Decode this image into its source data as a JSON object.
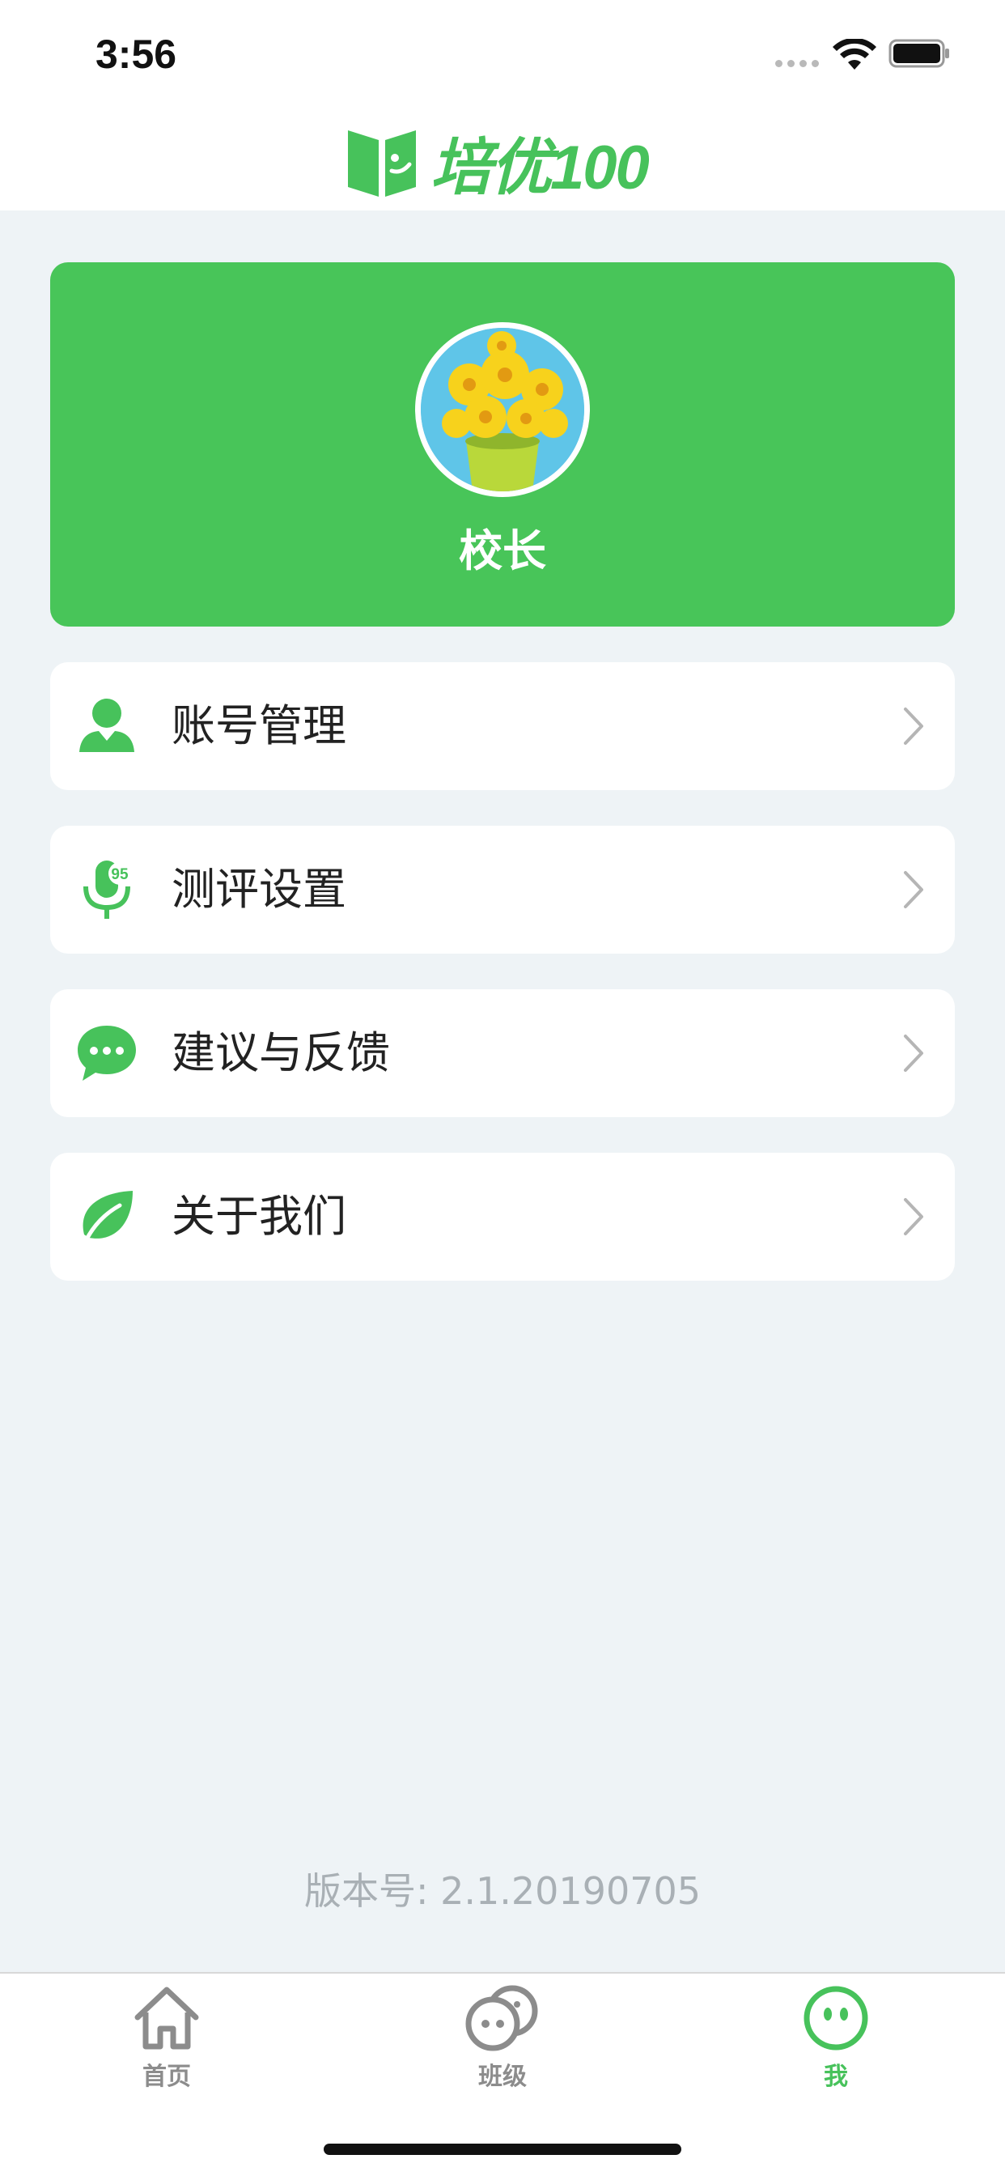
{
  "status_bar": {
    "time": "3:56"
  },
  "header": {
    "logo_text": "培优100"
  },
  "profile": {
    "name": "校长"
  },
  "menu": [
    {
      "label": "账号管理",
      "icon": "user-icon"
    },
    {
      "label": "测评设置",
      "icon": "microphone-score-icon",
      "icon_badge": "95"
    },
    {
      "label": "建议与反馈",
      "icon": "chat-bubble-icon"
    },
    {
      "label": "关于我们",
      "icon": "leaf-icon"
    }
  ],
  "footer": {
    "version": "版本号: 2.1.20190705"
  },
  "tabbar": {
    "tabs": [
      {
        "label": "首页",
        "icon": "home-icon",
        "active": false
      },
      {
        "label": "班级",
        "icon": "class-icon",
        "active": false
      },
      {
        "label": "我",
        "icon": "me-face-icon",
        "active": true
      }
    ]
  },
  "colors": {
    "accent": "#47c25b",
    "background": "#eef3f6",
    "inactive": "#8c8c8c"
  }
}
